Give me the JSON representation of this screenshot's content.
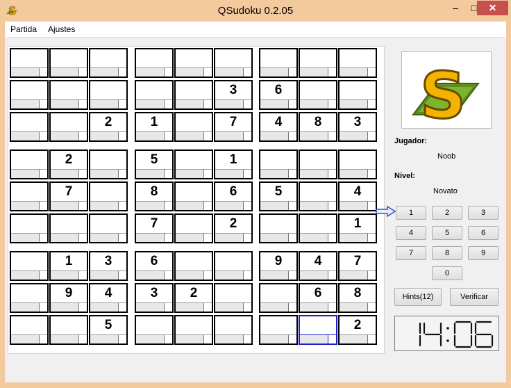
{
  "window": {
    "title": "QSudoku 0.2.05"
  },
  "menu": {
    "partida": "Partida",
    "ajustes": "Ajustes"
  },
  "board": {
    "rows": [
      [
        "",
        "",
        "",
        "",
        "",
        "",
        "",
        "",
        ""
      ],
      [
        "",
        "",
        "",
        "",
        "",
        "3",
        "6",
        "",
        ""
      ],
      [
        "",
        "",
        "2",
        "1",
        "",
        "7",
        "4",
        "8",
        "3"
      ],
      [
        "",
        "2",
        "",
        "5",
        "",
        "1",
        "",
        "",
        ""
      ],
      [
        "",
        "7",
        "",
        "8",
        "",
        "6",
        "5",
        "",
        "4"
      ],
      [
        "",
        "",
        "",
        "7",
        "",
        "2",
        "",
        "",
        "1"
      ],
      [
        "",
        "1",
        "3",
        "6",
        "",
        "",
        "9",
        "4",
        "7"
      ],
      [
        "",
        "9",
        "4",
        "3",
        "2",
        "",
        "",
        "6",
        "8"
      ],
      [
        "",
        "",
        "5",
        "",
        "",
        "",
        "",
        "",
        "2"
      ]
    ],
    "selected": {
      "row": 8,
      "col": 7
    }
  },
  "panel": {
    "player_label": "Jugador:",
    "player_name": "Noob",
    "level_label": "Nivel:",
    "level_name": "Novato",
    "number_buttons": [
      "1",
      "2",
      "3",
      "4",
      "5",
      "6",
      "7",
      "8",
      "9",
      "0"
    ],
    "hints_label": "Hints(12)",
    "verify_label": "Verificar",
    "clock": "14:06"
  }
}
